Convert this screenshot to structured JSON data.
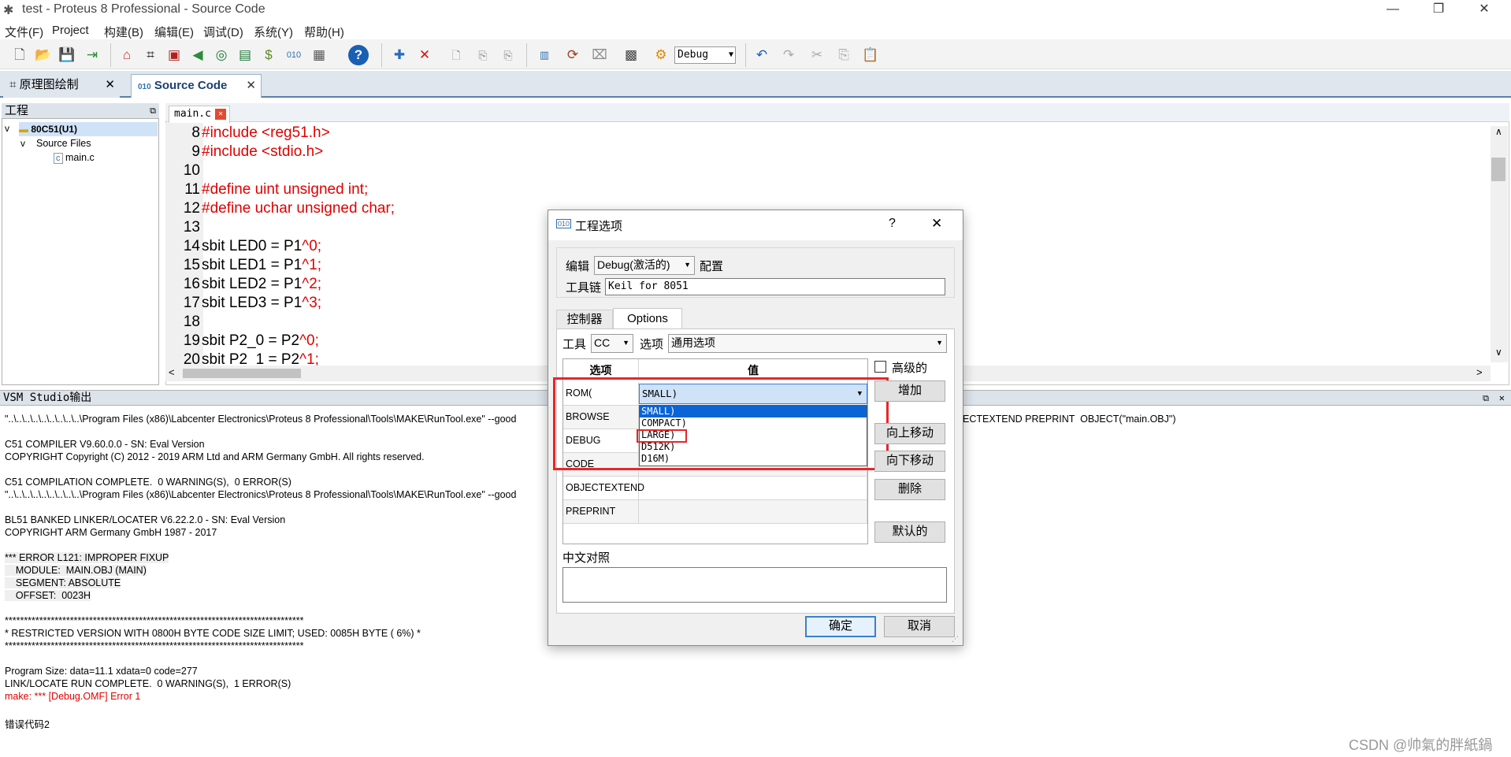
{
  "window": {
    "title": "test - Proteus 8 Professional - Source Code",
    "minimize": "—",
    "restore": "❐",
    "close": "✕"
  },
  "menu": [
    "文件(F)",
    "Project",
    "构建(B)",
    "编辑(E)",
    "调试(D)",
    "系统(Y)",
    "帮助(H)"
  ],
  "toolbar": {
    "config_combo": "Debug"
  },
  "doc_tabs": [
    {
      "label": "原理图绘制",
      "close": "✕"
    },
    {
      "label": "Source Code",
      "close": "✕"
    }
  ],
  "project_panel": {
    "title": "工程",
    "root": "80C51(U1)",
    "folder": "Source Files",
    "file": "main.c"
  },
  "editor": {
    "tab_label": "main.c",
    "lines": [
      {
        "n": "8",
        "text": "#include <reg51.h>",
        "kind": "pp"
      },
      {
        "n": "9",
        "text": "#include <stdio.h>",
        "kind": "pp"
      },
      {
        "n": "10",
        "text": "",
        "kind": "plain"
      },
      {
        "n": "11",
        "text": "#define uint unsigned int;",
        "kind": "pp"
      },
      {
        "n": "12",
        "text": "#define uchar unsigned char;",
        "kind": "pp"
      },
      {
        "n": "13",
        "text": "",
        "kind": "plain"
      },
      {
        "n": "14",
        "code": "sbit LED0 = P1",
        "caret": "^0;"
      },
      {
        "n": "15",
        "code": "sbit LED1 = P1",
        "caret": "^1;"
      },
      {
        "n": "16",
        "code": "sbit LED2 = P1",
        "caret": "^2;"
      },
      {
        "n": "17",
        "code": "sbit LED3 = P1",
        "caret": "^3;"
      },
      {
        "n": "18",
        "text": "",
        "kind": "plain"
      },
      {
        "n": "19",
        "code": "sbit P2_0 = P2",
        "caret": "^0;"
      },
      {
        "n": "20",
        "code": "sbit P2_1 = P2",
        "caret": "^1;"
      }
    ]
  },
  "output": {
    "title": "VSM Studio输出",
    "lines": [
      {
        "text": "\"..\\..\\..\\..\\..\\..\\..\\..\\..\\Program Files (x86)\\Labcenter Electronics\\Proteus 8 Professional\\Tools\\MAKE\\RunTool.exe\" --good",
        "kind": "plain"
      },
      {
        "text": "",
        "kind": "plain"
      },
      {
        "text": "C51 COMPILER V9.60.0.0 - SN: Eval Version",
        "kind": "plain"
      },
      {
        "text": "COPYRIGHT Copyright (C) 2012 - 2019 ARM Ltd and ARM Germany GmbH. All rights reserved.",
        "kind": "plain"
      },
      {
        "text": "",
        "kind": "plain"
      },
      {
        "text": "C51 COMPILATION COMPLETE.  0 WARNING(S),  0 ERROR(S)",
        "kind": "plain"
      },
      {
        "text": "\"..\\..\\..\\..\\..\\..\\..\\..\\..\\Program Files (x86)\\Labcenter Electronics\\Proteus 8 Professional\\Tools\\MAKE\\RunTool.exe\" --good",
        "kind": "plain"
      },
      {
        "text": "",
        "kind": "plain"
      },
      {
        "text": "BL51 BANKED LINKER/LOCATER V6.22.2.0 - SN: Eval Version",
        "kind": "plain"
      },
      {
        "text": "COPYRIGHT ARM Germany GmbH 1987 - 2017",
        "kind": "plain"
      },
      {
        "text": "",
        "kind": "plain"
      },
      {
        "text": "*** ERROR L121: IMPROPER FIXUP",
        "kind": "gray"
      },
      {
        "text": "    MODULE:  MAIN.OBJ (MAIN)",
        "kind": "gray"
      },
      {
        "text": "    SEGMENT: ABSOLUTE",
        "kind": "gray"
      },
      {
        "text": "    OFFSET:  0023H",
        "kind": "gray"
      },
      {
        "text": "",
        "kind": "plain"
      },
      {
        "text": "******************************************************************************",
        "kind": "plain"
      },
      {
        "text": "* RESTRICTED VERSION WITH 0800H BYTE CODE SIZE LIMIT; USED: 0085H BYTE ( 6%) *",
        "kind": "plain"
      },
      {
        "text": "******************************************************************************",
        "kind": "plain"
      },
      {
        "text": "",
        "kind": "plain"
      },
      {
        "text": "Program Size: data=11.1 xdata=0 code=277",
        "kind": "plain"
      },
      {
        "text": "LINK/LOCATE RUN COMPLETE.  0 WARNING(S),  1 ERROR(S)",
        "kind": "plain"
      },
      {
        "text": "make: *** [Debug.OMF] Error 1",
        "kind": "err"
      },
      {
        "text": "",
        "kind": "plain"
      },
      {
        "text": "错误代码2",
        "kind": "plain"
      }
    ],
    "right_fragment": "ECTEXTEND PREPRINT  OBJECT(\"main.OBJ\")"
  },
  "dialog": {
    "title": "工程选项",
    "help": "?",
    "close": "✕",
    "edit_label": "编辑",
    "edit_value": "Debug(激活的)",
    "config_label": "配置",
    "toolchain_label": "工具链",
    "toolchain_value": "Keil for 8051",
    "tabs": [
      "控制器",
      "Options"
    ],
    "tool_label": "工具",
    "tool_value": "CC",
    "option_label": "选项",
    "option_value": "通用选项",
    "grid_headers": [
      "选项",
      "值"
    ],
    "rows": [
      "ROM(",
      "BROWSE",
      "DEBUG",
      "CODE",
      "OBJECTEXTEND",
      "PREPRINT"
    ],
    "rom_value": "SMALL)",
    "dropdown_options": [
      "SMALL)",
      "COMPACT)",
      "LARGE)",
      "D512K)",
      "D16M)"
    ],
    "advanced_label": "高级的",
    "buttons": {
      "add": "增加",
      "move_up": "向上移动",
      "move_down": "向下移动",
      "delete": "删除",
      "default": "默认的",
      "ok": "确定",
      "cancel": "取消"
    },
    "chinese_label": "中文对照"
  },
  "watermark": "CSDN @帅氣的胖紙鍋"
}
